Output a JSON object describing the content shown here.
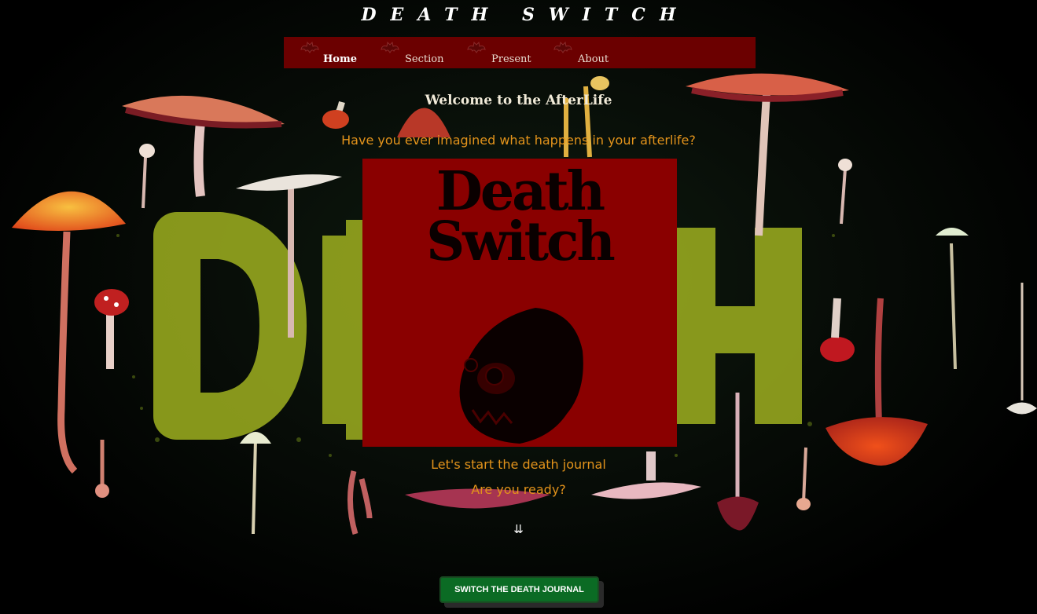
{
  "site": {
    "title": "DEATH SWITCH"
  },
  "nav": {
    "items": [
      {
        "label": "Home",
        "active": true,
        "icon": "bat-icon"
      },
      {
        "label": "Section",
        "active": false,
        "icon": "bat-icon"
      },
      {
        "label": "Present",
        "active": false,
        "icon": "bat-icon"
      },
      {
        "label": "About",
        "active": false,
        "icon": "bat-icon"
      }
    ],
    "background": "#6b0000"
  },
  "main": {
    "welcome": "Welcome to the AfterLife",
    "question": "Have you ever imagined what happens in your afterlife?",
    "hero": {
      "title_line1": "Death",
      "title_line2": "Switch",
      "background": "#8a0000",
      "icon": "skull-icon"
    },
    "journal_prompt": "Let's start the death journal",
    "ready_prompt": "Are you ready?",
    "scroll_hint": "⇊",
    "cta_label": "SWITCH THE DEATH JOURNAL"
  },
  "background": {
    "word": "DEATH",
    "description_icon": "mushroom-icon"
  },
  "colors": {
    "accent_orange": "#e3931b",
    "cta_green": "#0b6b24",
    "deep_red": "#8a0000"
  }
}
